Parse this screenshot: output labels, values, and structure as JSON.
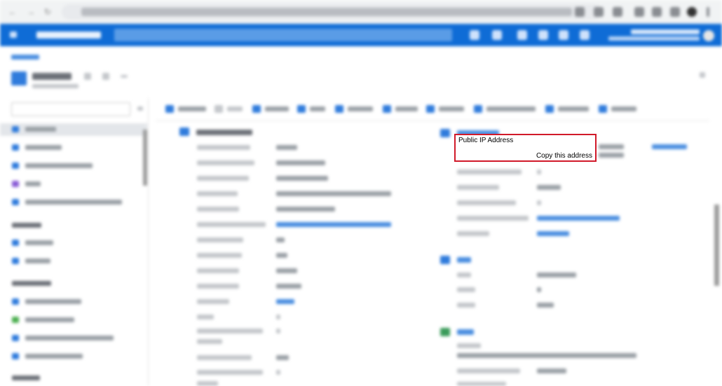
{
  "callout": {
    "title": "Public IP Address",
    "action": "Copy this address",
    "border_color": "#d11a2a"
  },
  "colors": {
    "azure_header": "#0f6cd6",
    "browser_bar": "#f1f3f4"
  },
  "icons": {
    "browser_back": "arrow-left-icon",
    "browser_forward": "arrow-right-icon",
    "browser_reload": "reload-icon",
    "portal_menu": "hamburger-icon"
  }
}
